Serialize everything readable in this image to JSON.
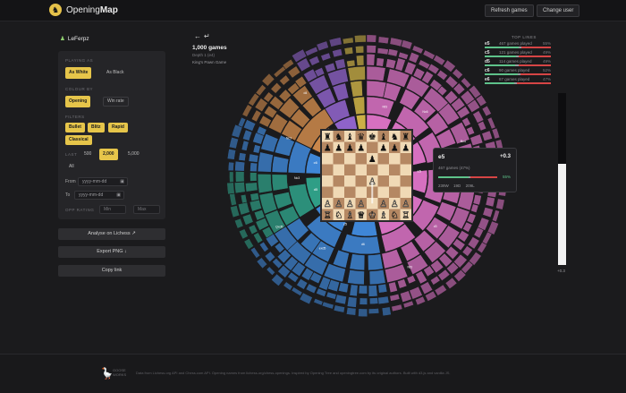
{
  "header": {
    "brand_light": "Opening",
    "brand_bold": "Map",
    "logo_glyph": "♞",
    "refresh_label": "Refresh games",
    "change_user_label": "Change user"
  },
  "user": {
    "icon": "pawn-icon",
    "glyph": "♟",
    "name": "LeFerpz"
  },
  "filters": {
    "playing_as_label": "PLAYING AS",
    "playing_as": [
      "As White",
      "As Black"
    ],
    "colour_by_label": "COLOUR BY",
    "colour_by": [
      "Opening",
      "Win rate"
    ],
    "filters_label": "FILTERS",
    "time_controls": [
      "Bullet",
      "Blitz",
      "Rapid",
      "Classical"
    ],
    "last_label": "LAST",
    "last_options": [
      "500",
      "2,000",
      "5,000",
      "All"
    ],
    "from_label": "From",
    "from_placeholder": "yyyy-mm-dd",
    "to_label": "To",
    "to_placeholder": "yyyy-mm-dd",
    "opp_rating_label": "OPP RATING",
    "min_placeholder": "Min",
    "max_placeholder": "Max"
  },
  "actions": {
    "lichess": "Analyse on Lichess ↗",
    "export": "Export PNG ↓",
    "copy": "Copy link"
  },
  "nav": {
    "back": "←",
    "forward": "↵"
  },
  "summary": {
    "games": "1,000 games",
    "depth": "Depth 1 (e4)",
    "opening": "King's Pawn Game"
  },
  "tooltip": {
    "move": "e5",
    "eval": "+0.3",
    "games": "467 games (47%)",
    "win_rate": "55%",
    "wins": "239W",
    "draws": "19D",
    "losses": "209L",
    "win_frac": 0.51,
    "draw_frac": 0.04
  },
  "top_lines": {
    "title": "TOP LINES",
    "items": [
      {
        "move": "e5",
        "games": "467 games played",
        "pct": "55%",
        "win": 0.51,
        "draw": 0.04
      },
      {
        "move": "c5",
        "games": "121 games played",
        "pct": "49%",
        "win": 0.47,
        "draw": 0.04
      },
      {
        "move": "d5",
        "games": "114 games played",
        "pct": "49%",
        "win": 0.46,
        "draw": 0.05
      },
      {
        "move": "c6",
        "games": "90 games played",
        "pct": "52%",
        "win": 0.5,
        "draw": 0.04
      },
      {
        "move": "e6",
        "games": "87 games played",
        "pct": "47%",
        "win": 0.45,
        "draw": 0.04
      }
    ]
  },
  "eval_bar": {
    "label": "+0.3",
    "white_frac": 0.59
  },
  "board": {
    "rows": [
      "rnbqkbnr",
      "pppp.ppp",
      "....p...",
      "........",
      "....P...",
      "........",
      "PPPP.PPP",
      "RNBQKBNR"
    ],
    "light": "#f0d9b5",
    "dark": "#b58863"
  },
  "sunburst": {
    "colors": {
      "pink": "#d670c0",
      "pink_dark": "#a84a95",
      "blue": "#3f86d6",
      "teal": "#2f9e86",
      "orange": "#c9864a",
      "violet": "#8f63c9",
      "gold": "#cbb046"
    },
    "segments": [
      {
        "label": "e5",
        "color": "pink"
      },
      {
        "label": "c5",
        "color": "blue"
      },
      {
        "label": "d5",
        "color": "teal"
      },
      {
        "label": "c6",
        "color": "orange"
      },
      {
        "label": "e6",
        "color": "violet"
      },
      {
        "label": "",
        "color": "gold"
      }
    ],
    "ring_labels": [
      "Nf3",
      "Nc6",
      "Bc4",
      "Nf6",
      "d3",
      "Nf3",
      "d6",
      "exd5",
      "Qxd5",
      "Nc3",
      "Nc3",
      "d4"
    ]
  },
  "footer": {
    "brand": "GOOSE WORKS",
    "text": "Data from Lichess.org API and Chess.com API. Opening names from lichess-org/chess-openings. Inspired by Opening Tree and openingtree.com by its original authors. Built with d3.js and vanilla JS."
  }
}
